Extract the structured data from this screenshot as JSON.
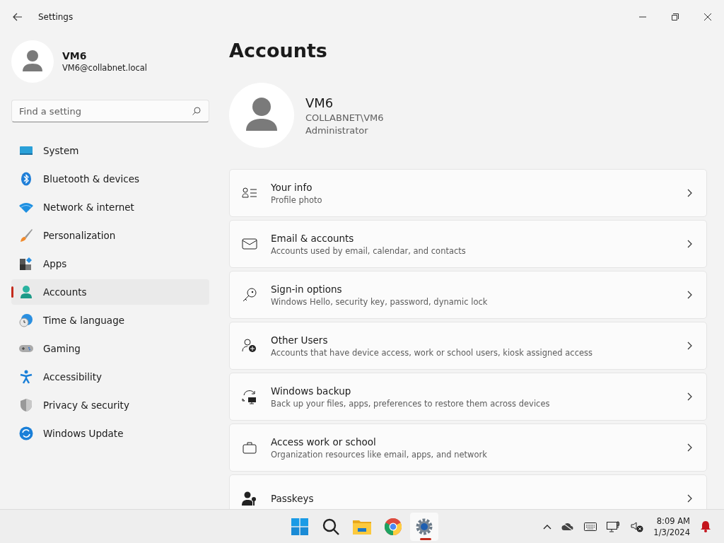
{
  "window": {
    "title": "Settings"
  },
  "profile": {
    "name": "VM6",
    "email": "VM6@collabnet.local"
  },
  "search": {
    "placeholder": "Find a setting"
  },
  "sidebar": {
    "items": [
      {
        "label": "System",
        "selected": false
      },
      {
        "label": "Bluetooth & devices",
        "selected": false
      },
      {
        "label": "Network & internet",
        "selected": false
      },
      {
        "label": "Personalization",
        "selected": false
      },
      {
        "label": "Apps",
        "selected": false
      },
      {
        "label": "Accounts",
        "selected": true
      },
      {
        "label": "Time & language",
        "selected": false
      },
      {
        "label": "Gaming",
        "selected": false
      },
      {
        "label": "Accessibility",
        "selected": false
      },
      {
        "label": "Privacy & security",
        "selected": false
      },
      {
        "label": "Windows Update",
        "selected": false
      }
    ]
  },
  "page": {
    "title": "Accounts"
  },
  "account": {
    "name": "VM6",
    "domain": "COLLABNET\\VM6",
    "role": "Administrator"
  },
  "cards": [
    {
      "title": "Your info",
      "subtitle": "Profile photo"
    },
    {
      "title": "Email & accounts",
      "subtitle": "Accounts used by email, calendar, and contacts"
    },
    {
      "title": "Sign-in options",
      "subtitle": "Windows Hello, security key, password, dynamic lock"
    },
    {
      "title": "Other Users",
      "subtitle": "Accounts that have device access, work or school users, kiosk assigned access"
    },
    {
      "title": "Windows backup",
      "subtitle": "Back up your files, apps, preferences to restore them across devices"
    },
    {
      "title": "Access work or school",
      "subtitle": "Organization resources like email, apps, and network"
    },
    {
      "title": "Passkeys"
    }
  ],
  "taskbar": {
    "apps": [
      {
        "selected": false
      },
      {
        "selected": false
      },
      {
        "selected": false
      },
      {
        "selected": false
      },
      {
        "selected": true
      }
    ],
    "time": "8:09 AM",
    "date": "1/3/2024"
  }
}
